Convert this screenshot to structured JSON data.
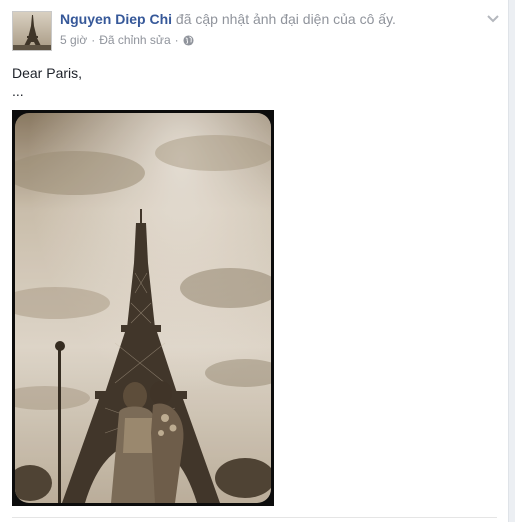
{
  "post": {
    "author": "Nguyen Diep Chi",
    "action": "đã cập nhật ảnh đại diện của cô ấy.",
    "time": "5 giờ",
    "edited": "Đã chỉnh sửa",
    "separator": "·",
    "privacy_icon": "globe-icon",
    "menu_icon": "chevron-down-icon",
    "text_line1": "Dear Paris,",
    "text_line2": "..."
  },
  "colors": {
    "author_link": "#365899",
    "meta_gray": "#90949c",
    "photo_tone": "#b9a98f"
  }
}
